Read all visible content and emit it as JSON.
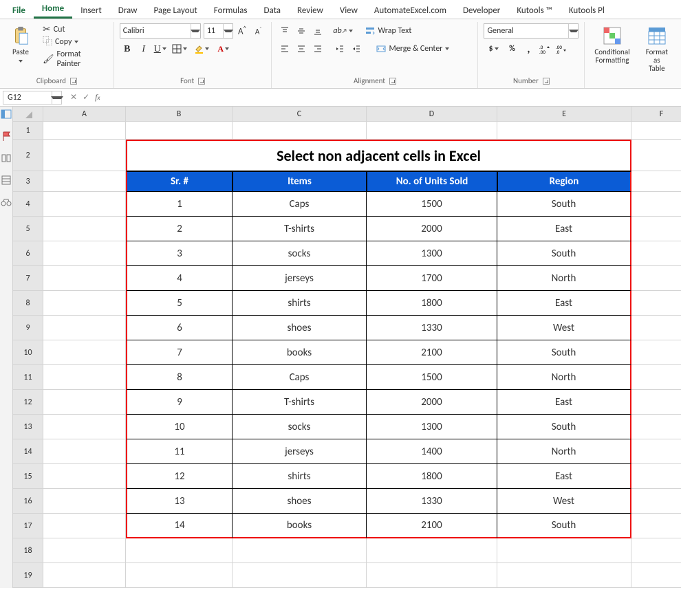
{
  "tabs": [
    "File",
    "Home",
    "Insert",
    "Draw",
    "Page Layout",
    "Formulas",
    "Data",
    "Review",
    "View",
    "AutomateExcel.com",
    "Developer",
    "Kutools ™",
    "Kutools Pl"
  ],
  "active_tab": "Home",
  "clipboard": {
    "paste": "Paste",
    "cut": "Cut",
    "copy": "Copy",
    "format_painter": "Format Painter",
    "label": "Clipboard"
  },
  "font": {
    "name": "Calibri",
    "size": "11",
    "label": "Font"
  },
  "alignment": {
    "wrap": "Wrap Text",
    "merge": "Merge & Center",
    "label": "Alignment"
  },
  "number": {
    "format": "General",
    "label": "Number"
  },
  "styles": {
    "cf": "Conditional\nFormatting",
    "fat": "Format as\nTable"
  },
  "namebox": "G12",
  "formula": "",
  "columns": [
    "A",
    "B",
    "C",
    "D",
    "E",
    "F"
  ],
  "row_numbers": [
    "1",
    "2",
    "3",
    "4",
    "5",
    "6",
    "7",
    "8",
    "9",
    "10",
    "11",
    "12",
    "13",
    "14",
    "15",
    "16",
    "17",
    "18",
    "19"
  ],
  "sheet": {
    "title": "Select non adjacent cells in Excel",
    "headers": [
      "Sr. #",
      "Items",
      "No. of Units Sold",
      "Region"
    ],
    "rows": [
      [
        "1",
        "Caps",
        "1500",
        "South"
      ],
      [
        "2",
        "T-shirts",
        "2000",
        "East"
      ],
      [
        "3",
        "socks",
        "1300",
        "South"
      ],
      [
        "4",
        "jerseys",
        "1700",
        "North"
      ],
      [
        "5",
        "shirts",
        "1800",
        "East"
      ],
      [
        "6",
        "shoes",
        "1330",
        "West"
      ],
      [
        "7",
        "books",
        "2100",
        "South"
      ],
      [
        "8",
        "Caps",
        "1500",
        "North"
      ],
      [
        "9",
        "T-shirts",
        "2000",
        "East"
      ],
      [
        "10",
        "socks",
        "1300",
        "South"
      ],
      [
        "11",
        "jerseys",
        "1400",
        "North"
      ],
      [
        "12",
        "shirts",
        "1800",
        "East"
      ],
      [
        "13",
        "shoes",
        "1330",
        "West"
      ],
      [
        "14",
        "books",
        "2100",
        "South"
      ]
    ]
  }
}
